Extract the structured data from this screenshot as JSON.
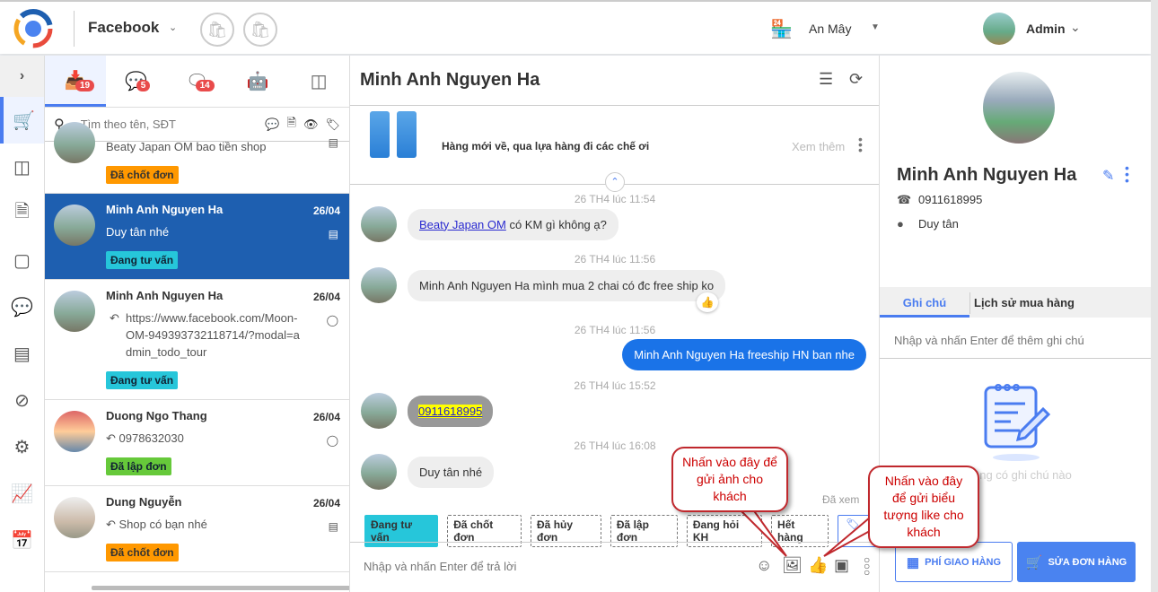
{
  "header": {
    "channel": "Facebook",
    "shop": "An Mây",
    "user": "Admin"
  },
  "tabs": [
    {
      "icon": "inbox-icon",
      "count": "19"
    },
    {
      "icon": "messenger-icon",
      "count": "5"
    },
    {
      "icon": "comment-icon",
      "count": "14"
    },
    {
      "icon": "bot-icon"
    },
    {
      "icon": "video-icon"
    }
  ],
  "search": {
    "placeholder": "Tìm theo tên, SĐT"
  },
  "conversations": [
    {
      "name": "",
      "date": "",
      "message": "Beaty Japan OM bao tiền shop",
      "tag": "Đã chốt đơn"
    },
    {
      "name": "Minh Anh Nguyen Ha",
      "date": "26/04",
      "message": "Duy tân nhé",
      "tag": "Đang tư vấn"
    },
    {
      "name": "Minh Anh Nguyen Ha",
      "date": "26/04",
      "message": "https://www.facebook.com/Moon-OM-949393732118714/?modal=admin_todo_tour",
      "tag": "Đang tư vấn"
    },
    {
      "name": "Duong Ngo Thang",
      "date": "26/04",
      "message": "0978632030",
      "tag": "Đã lập đơn"
    },
    {
      "name": "Dung Nguyễn",
      "date": "26/04",
      "message": "Shop có bạn nhé",
      "tag": "Đã chốt đơn"
    }
  ],
  "chat": {
    "title": "Minh Anh Nguyen Ha",
    "pinned": {
      "text": "Hàng mới về, qua lựa hàng đi các chế ơi",
      "more": "Xem thêm"
    },
    "messages": [
      {
        "time": "26 TH4 lúc 11:54",
        "link": "Beaty Japan OM",
        "text": "có KM gì không ạ?"
      },
      {
        "time": "26 TH4 lúc 11:56",
        "text": "Minh Anh Nguyen Ha mình mua 2 chai có đc free ship ko"
      },
      {
        "time": "26 TH4 lúc 11:56",
        "text": "Minh Anh Nguyen Ha freeship HN ban nhe"
      },
      {
        "time": "26 TH4 lúc 15:52",
        "text": "0911618995"
      },
      {
        "time": "26 TH4 lúc 16:08",
        "text": "Duy tân nhé"
      }
    ],
    "seen": "Đã xem",
    "chips": [
      "Đang tư vấn",
      "Đã chốt đơn",
      "Đã hủy đơn",
      "Đã lập đơn",
      "Đang hỏi KH",
      "Hết hàng"
    ],
    "composer_placeholder": "Nhập và nhấn Enter để trả lời"
  },
  "customer": {
    "name": "Minh Anh Nguyen Ha",
    "phone": "0911618995",
    "address": "Duy tân",
    "tabs": [
      "Ghi chú",
      "Lịch sử mua hàng"
    ],
    "note_placeholder": "Nhập và nhấn Enter để thêm ghi chú",
    "empty": "Không có ghi chú nào",
    "btn_fee": "PHÍ GIAO HÀNG",
    "btn_edit": "SỬA ĐƠN HÀNG"
  },
  "callouts": {
    "image": "Nhấn vào đây để gửi ảnh cho khách",
    "like": "Nhấn vào đây để gửi biểu tượng like cho khách"
  },
  "colors": {
    "accent": "#4a7cf0",
    "selected": "#1e5fb0",
    "callout": "#c0282d"
  }
}
